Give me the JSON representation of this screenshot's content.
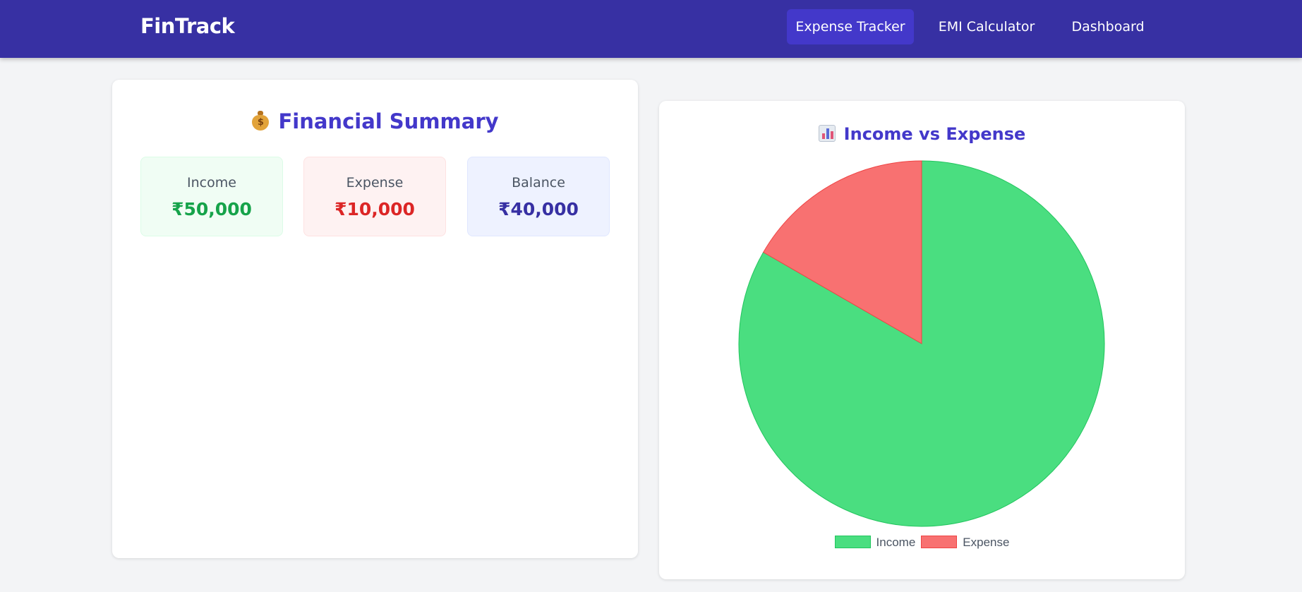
{
  "nav": {
    "brand": "FinTrack",
    "links": [
      "Expense Tracker",
      "EMI Calculator",
      "Dashboard"
    ],
    "active": "Expense Tracker"
  },
  "summary": {
    "title": "Financial Summary",
    "title_icon": "money-bag-icon",
    "stats": [
      {
        "label": "Income",
        "value": "₹50,000",
        "color": "#16a34a"
      },
      {
        "label": "Expense",
        "value": "₹10,000",
        "color": "#dc2626"
      },
      {
        "label": "Balance",
        "value": "₹40,000",
        "color": "#3730a3"
      }
    ]
  },
  "chart_panel": {
    "title": "Income vs Expense",
    "title_icon": "bar-chart-icon"
  },
  "chart_data": {
    "type": "pie",
    "title": "Income vs Expense",
    "labels": [
      "Income",
      "Expense"
    ],
    "values": [
      50000,
      10000
    ],
    "colors": [
      "#4ade80",
      "#f87171"
    ],
    "borders": [
      "#22c55e",
      "#ef4444"
    ],
    "legend": "bottom"
  },
  "colors": {
    "navbar": "#3730a3",
    "nav_active": "#4338ca",
    "accent": "#4338ca",
    "background": "#f3f4f6"
  }
}
